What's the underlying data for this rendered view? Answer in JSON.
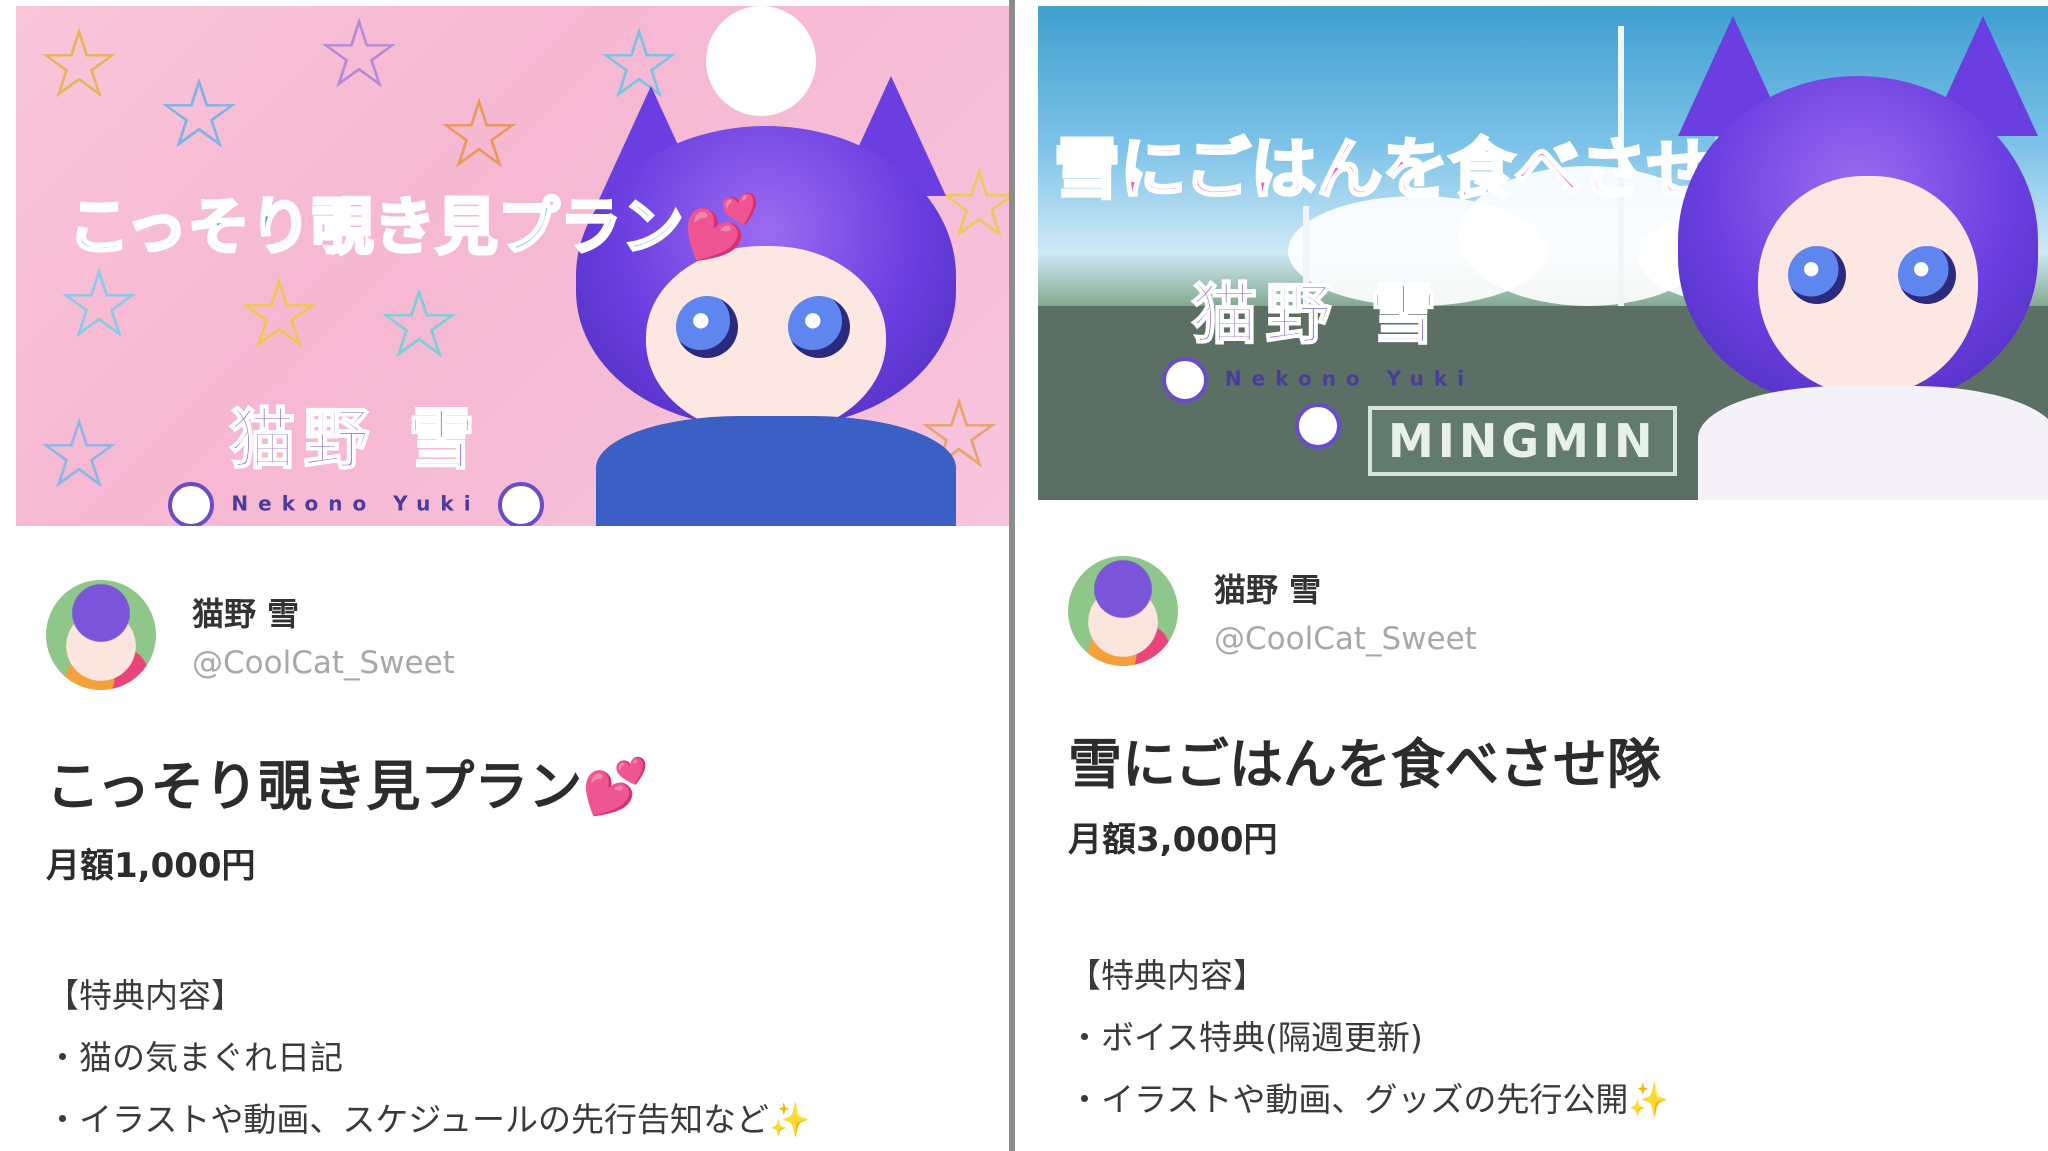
{
  "left": {
    "banner": {
      "title": "こっそり覗き見プラン💕",
      "logo_main": "猫野 雪",
      "logo_sub": "Nekono Yuki"
    },
    "profile": {
      "name": "猫野 雪",
      "handle": "@CoolCat_Sweet"
    },
    "plan_title": "こっそり覗き見プラン💕",
    "price": "月額1,000円",
    "benefits_header": "【特典内容】",
    "benefits": [
      "・猫の気まぐれ日記",
      "・イラストや動画、スケジュールの先行告知など✨"
    ]
  },
  "right": {
    "banner": {
      "title": "雪にごはんを食べさせ隊",
      "logo_main": "猫野 雪",
      "logo_sub": "Nekono Yuki",
      "sign": "MINGMIN"
    },
    "profile": {
      "name": "猫野 雪",
      "handle": "@CoolCat_Sweet"
    },
    "plan_title": "雪にごはんを食べさせ隊",
    "price": "月額3,000円",
    "benefits_header": "【特典内容】",
    "benefits": [
      "・ボイス特典(隔週更新)",
      "・イラストや動画、グッズの先行公開✨"
    ]
  },
  "colors": {
    "left_banner_bg": "#f7c4dd",
    "left_title": "#2fa7e8",
    "right_title": "#ef5fbd",
    "divider": "#8c8c8c",
    "handle": "#a8a8a8"
  },
  "icons": [
    "paw-icon",
    "star-icon",
    "heart-icon",
    "sparkle-icon"
  ]
}
